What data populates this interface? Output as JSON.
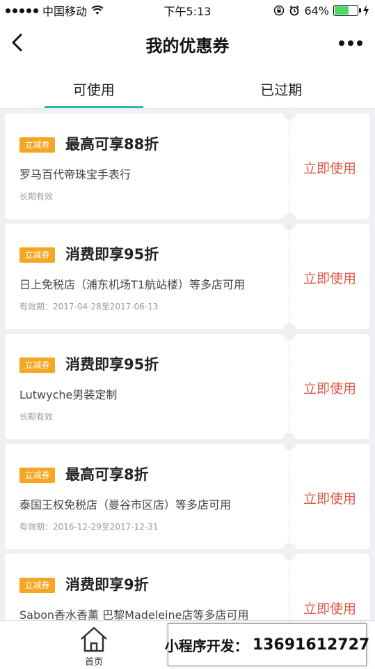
{
  "status_bar": {
    "carrier": "中国移动",
    "time": "下午5:13",
    "battery": "64%",
    "battery_level": 0.64,
    "icons": [
      "signal-dots-icon",
      "wifi-icon",
      "lock-rotation-icon",
      "alarm-icon",
      "battery-icon",
      "charging-icon"
    ]
  },
  "nav": {
    "title": "我的优惠券",
    "back_icon": "chevron-left-icon",
    "more_icon": "more-dots-icon"
  },
  "tabs": [
    {
      "label": "可使用",
      "active": true
    },
    {
      "label": "已过期",
      "active": false
    }
  ],
  "colors": {
    "accent": "#2fb8a5",
    "badge": "#f5a623",
    "use_button": "#e05a4a"
  },
  "coupons": [
    {
      "badge": "立减券",
      "title": "最高可享88折",
      "store": "罗马百代帝珠宝手表行",
      "validity": "长期有效",
      "action": "立即使用"
    },
    {
      "badge": "立减券",
      "title": "消费即享95折",
      "store": "日上免税店（浦东机场T1航站楼）等多店可用",
      "validity": "有效期：2017-04-28至2017-06-13",
      "action": "立即使用"
    },
    {
      "badge": "立减券",
      "title": "消费即享95折",
      "store": "Lutwyche男装定制",
      "validity": "长期有效",
      "action": "立即使用"
    },
    {
      "badge": "立减券",
      "title": "最高可享8折",
      "store": "泰国王权免税店（曼谷市区店）等多店可用",
      "validity": "有效期：2016-12-29至2017-12-31",
      "action": "立即使用"
    },
    {
      "badge": "立减券",
      "title": "消费即享9折",
      "store": "Sabon香水香薰 巴黎Madeleine店等多店可用",
      "validity": "",
      "action": "立即使用"
    }
  ],
  "bottom_bar": {
    "home_label": "首页",
    "home_icon": "home-icon"
  },
  "promo": {
    "label": "小程序开发：",
    "phone": "13691612727"
  }
}
